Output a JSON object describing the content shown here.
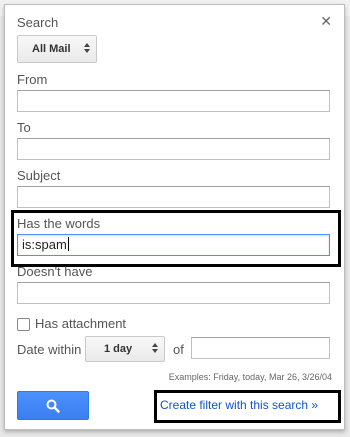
{
  "popup": {
    "search_label": "Search",
    "close_icon": "close-icon",
    "mail_scope": "All Mail",
    "from_label": "From",
    "from_value": "",
    "to_label": "To",
    "to_value": "",
    "subject_label": "Subject",
    "subject_value": "",
    "has_words_label": "Has the words",
    "has_words_value": "is:spam",
    "doesnt_have_label": "Doesn't have",
    "doesnt_have_value": "",
    "has_attachment_label": "Has attachment",
    "date_within_label": "Date within",
    "date_within_value": "1 day",
    "of_label": "of",
    "date_value": "",
    "examples_text": "Examples: Friday, today, Mar 26, 3/26/04",
    "search_button_icon": "search-icon",
    "create_filter_label": "Create filter with this search »"
  },
  "colors": {
    "accent_blue": "#4d90fe",
    "link_blue": "#1155cc"
  }
}
